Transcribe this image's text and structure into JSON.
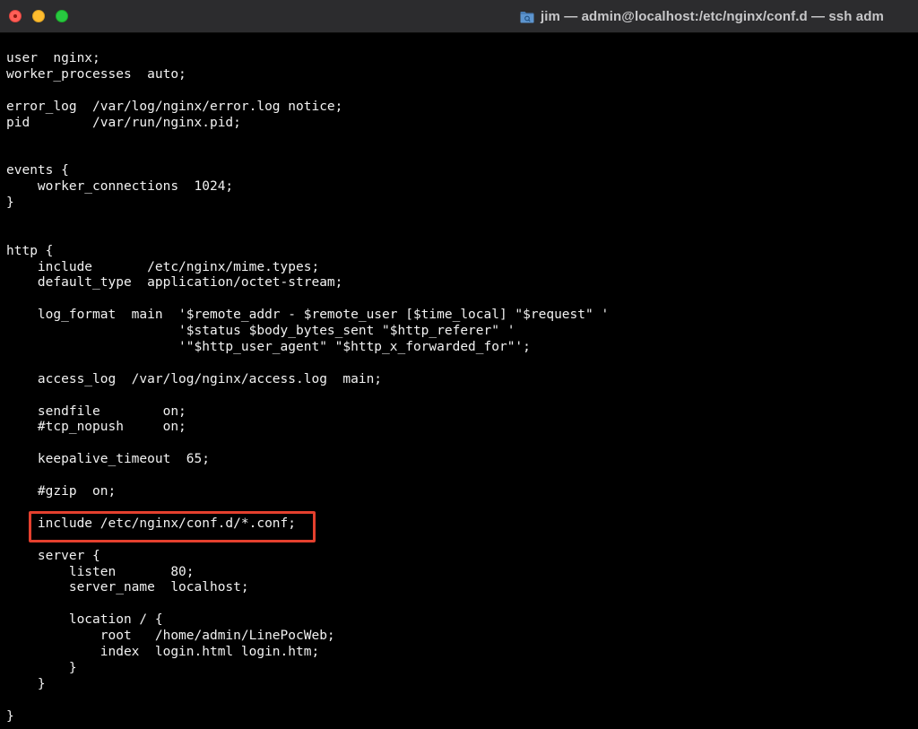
{
  "window": {
    "title": "jim — admin@localhost:/etc/nginx/conf.d — ssh adm",
    "title_icon": "folder-icon",
    "colors": {
      "background": "#000000",
      "text": "#f2f2f2",
      "titlebar": "#2c2c2e",
      "highlight_border": "#e4402e"
    }
  },
  "terminal": {
    "lines": [
      "user  nginx;",
      "worker_processes  auto;",
      "",
      "error_log  /var/log/nginx/error.log notice;",
      "pid        /var/run/nginx.pid;",
      "",
      "",
      "events {",
      "    worker_connections  1024;",
      "}",
      "",
      "",
      "http {",
      "    include       /etc/nginx/mime.types;",
      "    default_type  application/octet-stream;",
      "",
      "    log_format  main  '$remote_addr - $remote_user [$time_local] \"$request\" '",
      "                      '$status $body_bytes_sent \"$http_referer\" '",
      "                      '\"$http_user_agent\" \"$http_x_forwarded_for\"';",
      "",
      "    access_log  /var/log/nginx/access.log  main;",
      "",
      "    sendfile        on;",
      "    #tcp_nopush     on;",
      "",
      "    keepalive_timeout  65;",
      "",
      "    #gzip  on;",
      "",
      "    include /etc/nginx/conf.d/*.conf;",
      "",
      "    server {",
      "        listen       80;",
      "        server_name  localhost;",
      "",
      "        location / {",
      "            root   /home/admin/LinePocWeb;",
      "            index  login.html login.htm;",
      "        }",
      "    }",
      "",
      "}"
    ],
    "highlighted_line": "include /etc/nginx/conf.d/*.conf;"
  }
}
